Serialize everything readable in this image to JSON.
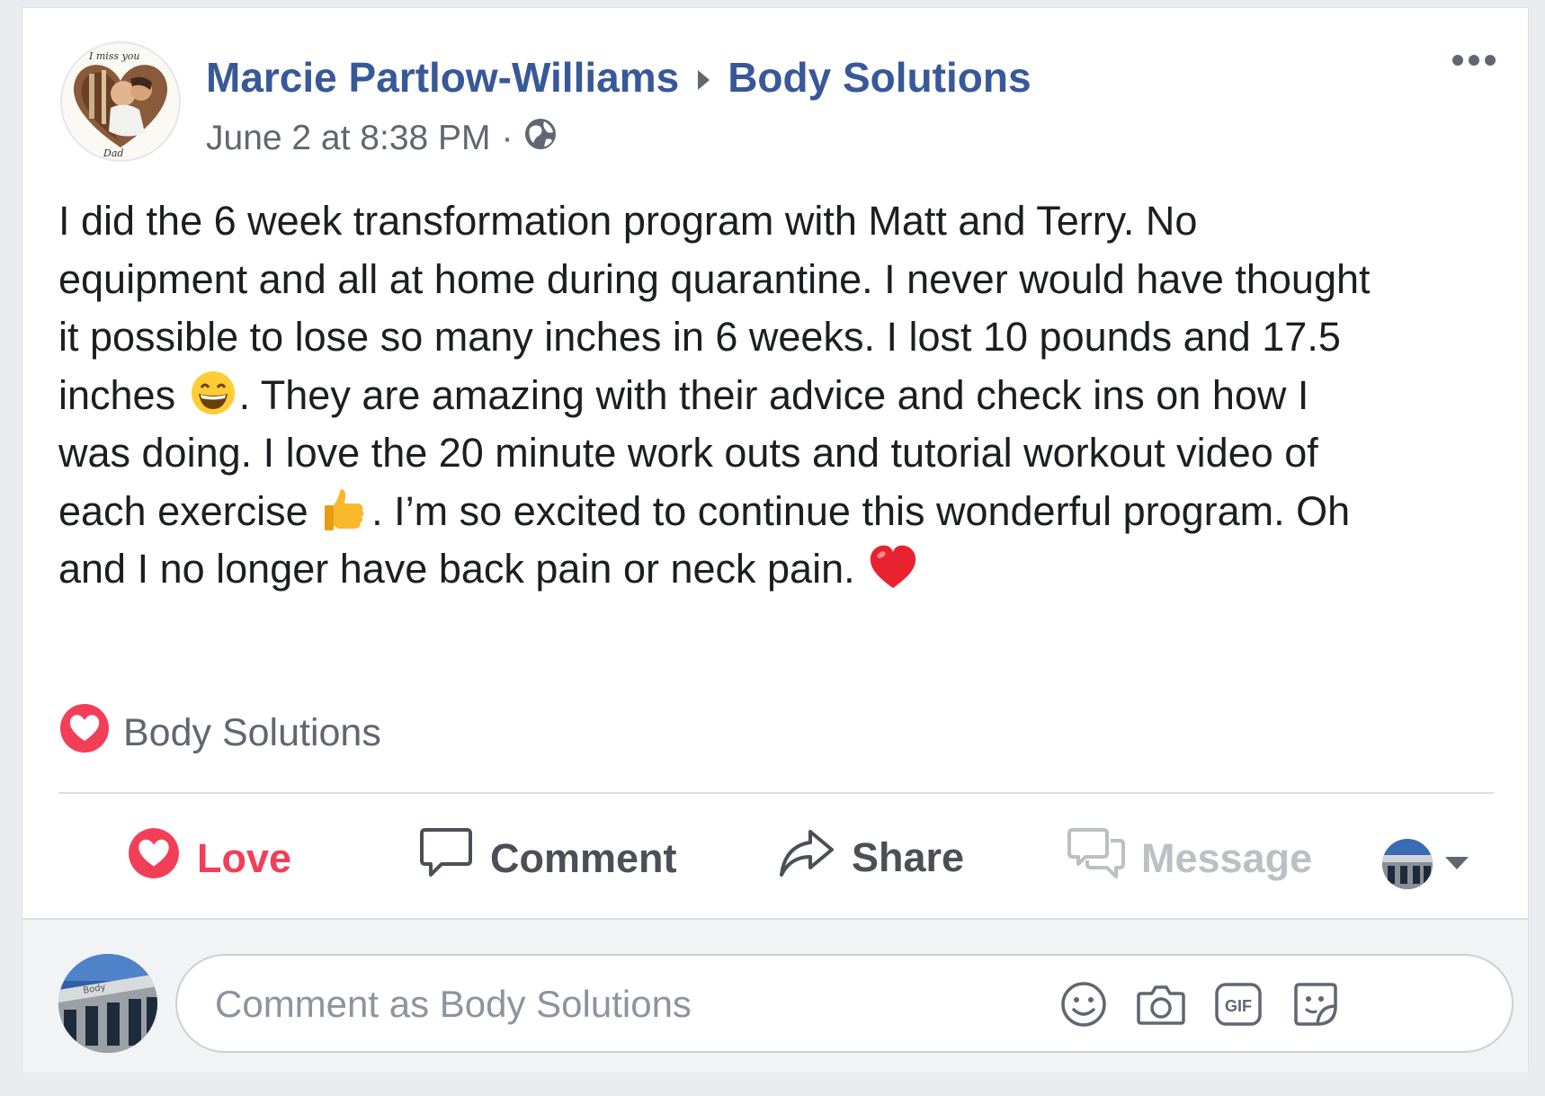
{
  "post": {
    "author": "Marcie Partlow-Williams",
    "target_page": "Body Solutions",
    "timestamp": "June 2 at 8:38 PM",
    "audience_icon": "globe-icon",
    "avatar_note_top": "I miss you",
    "avatar_note_bottom": "Dad",
    "text_lines": [
      [
        "I did the 6 week transformation program with Matt and Terry. No"
      ],
      [
        "equipment and all at home during quarantine. I never would have thought"
      ],
      [
        "it possible to lose so many inches in 6 weeks. I lost 10 pounds and 17.5"
      ],
      [
        "inches",
        ". They are amazing with their advice and check ins on how I"
      ],
      [
        "was doing. I love the 20 minute work outs and tutorial workout video of"
      ],
      [
        "each exercise",
        ". I’m so excited to continue this wonderful program. Oh"
      ],
      [
        "and I no longer have back pain or neck pain."
      ]
    ],
    "emojis": [
      "grinning-face-icon",
      "thumbs-up-icon",
      "red-heart-icon"
    ]
  },
  "reactions": {
    "icon": "love-reaction-icon",
    "names": "Body Solutions"
  },
  "actions": {
    "love_label": "Love",
    "comment_label": "Comment",
    "share_label": "Share",
    "message_label": "Message"
  },
  "comment": {
    "placeholder": "Comment as Body Solutions",
    "gif_label": "GIF",
    "icons": [
      "emoji-icon",
      "camera-icon",
      "gif-icon",
      "sticker-icon"
    ]
  },
  "colors": {
    "link_blue": "#385898",
    "love_red": "#f33e58",
    "secondary_text": "#606770",
    "disabled_text": "#bcc0c4"
  }
}
